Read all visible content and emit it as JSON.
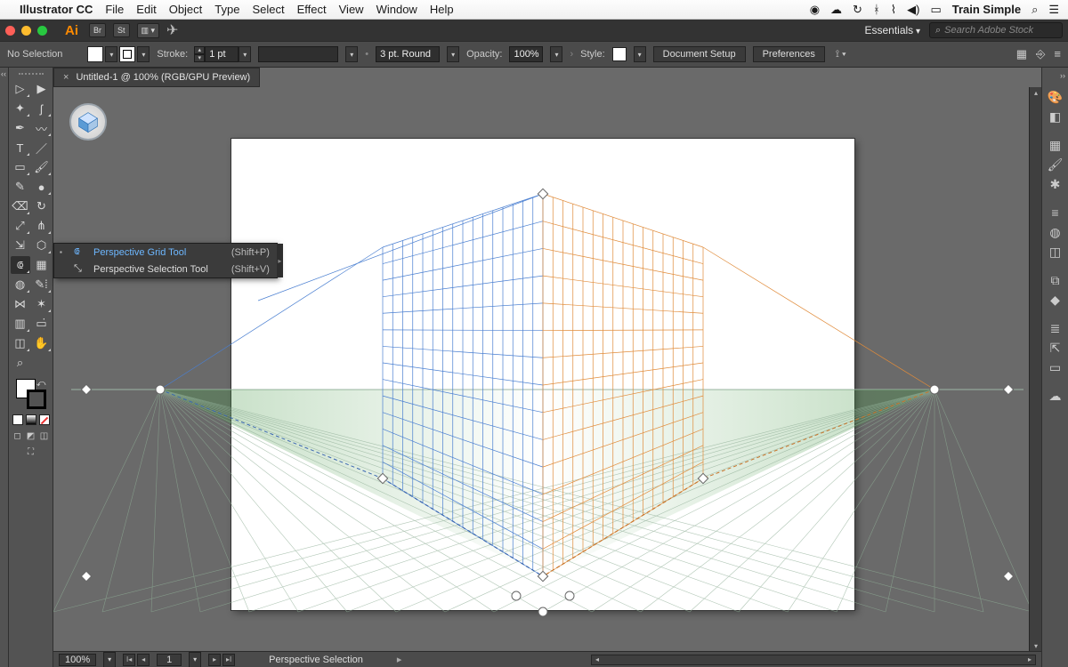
{
  "mac_menu": {
    "app": "Illustrator CC",
    "items": [
      "File",
      "Edit",
      "Object",
      "Type",
      "Select",
      "Effect",
      "View",
      "Window",
      "Help"
    ],
    "right_brand": "Train Simple"
  },
  "ai_bar": {
    "workspace": "Essentials",
    "stock_placeholder": "Search Adobe Stock"
  },
  "control": {
    "sel_label": "No Selection",
    "stroke_label": "Stroke:",
    "stroke_value": "1 pt",
    "profile_value": "3 pt. Round",
    "opacity_label": "Opacity:",
    "opacity_value": "100%",
    "style_label": "Style:",
    "doc_setup": "Document Setup",
    "prefs": "Preferences"
  },
  "doc_tab": {
    "title": "Untitled-1 @ 100% (RGB/GPU Preview)"
  },
  "flyout": {
    "items": [
      {
        "name": "Perspective Grid Tool",
        "shortcut": "(Shift+P)",
        "selected": true
      },
      {
        "name": "Perspective Selection Tool",
        "shortcut": "(Shift+V)",
        "selected": false
      }
    ]
  },
  "status": {
    "zoom": "100%",
    "artboard": "1",
    "tool": "Perspective Selection"
  },
  "tool_names": [
    "selection",
    "direct-selection",
    "magic-wand",
    "lasso",
    "pen",
    "curvature",
    "type",
    "line",
    "rectangle",
    "paintbrush",
    "pencil",
    "blob-brush",
    "eraser",
    "rotate",
    "scale",
    "width",
    "free-transform",
    "shape-builder",
    "perspective-grid",
    "mesh",
    "gradient",
    "eyedropper",
    "blend",
    "symbol-sprayer",
    "column-graph",
    "artboard",
    "slice",
    "hand",
    "zoom"
  ],
  "right_icons": [
    "color",
    "color-guide",
    "swatches",
    "brushes",
    "symbols",
    "stroke",
    "gradient",
    "transparency",
    "appearance",
    "graphic-styles",
    "layers",
    "asset-export",
    "artboards",
    "cc-libraries"
  ]
}
